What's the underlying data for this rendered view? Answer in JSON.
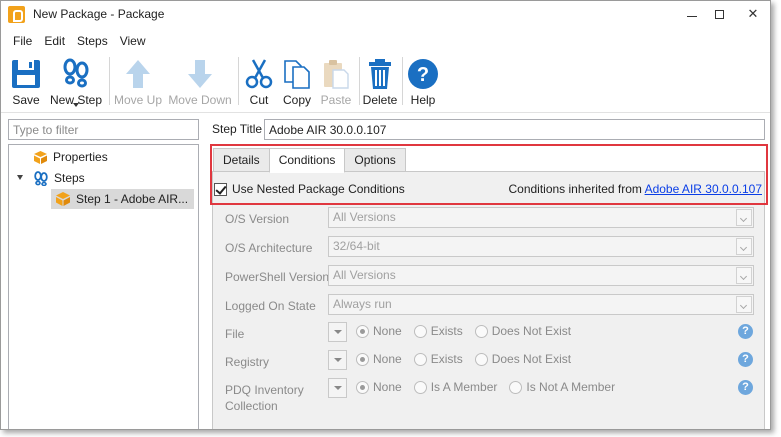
{
  "window": {
    "title": "New Package - Package"
  },
  "menu": {
    "items": [
      "File",
      "Edit",
      "Steps",
      "View"
    ]
  },
  "toolbar": {
    "save": "Save",
    "new_step": "New Step",
    "move_up": "Move Up",
    "move_down": "Move Down",
    "cut": "Cut",
    "copy": "Copy",
    "paste": "Paste",
    "delete": "Delete",
    "help": "Help"
  },
  "filter": {
    "placeholder": "Type to filter"
  },
  "tree": {
    "properties": "Properties",
    "steps": "Steps",
    "step1": "Step 1 - Adobe AIR..."
  },
  "step": {
    "title_label": "Step Title",
    "title_value": "Adobe AIR 30.0.0.107"
  },
  "tabs": {
    "details": "Details",
    "conditions": "Conditions",
    "options": "Options",
    "active": "Conditions"
  },
  "conditions": {
    "use_nested_label": "Use Nested Package Conditions",
    "use_nested_checked": true,
    "inherited_prefix": "Conditions inherited from ",
    "inherited_link": "Adobe AIR 30.0.0.107",
    "os_version_label": "O/S Version",
    "os_version_value": "All Versions",
    "os_arch_label": "O/S Architecture",
    "os_arch_value": "32/64-bit",
    "powershell_label": "PowerShell Version",
    "powershell_value": "All Versions",
    "logged_on_label": "Logged On State",
    "logged_on_value": "Always run",
    "file_label": "File",
    "file_opts": [
      "None",
      "Exists",
      "Does Not Exist"
    ],
    "registry_label": "Registry",
    "registry_opts": [
      "None",
      "Exists",
      "Does Not Exist"
    ],
    "pdq_label_line1": "PDQ Inventory",
    "pdq_label_line2": "Collection",
    "pdq_opts": [
      "None",
      "Is A Member",
      "Is Not A Member"
    ]
  },
  "colors": {
    "highlight": "#e0373f",
    "link": "#0a3ee6",
    "toolbar_blue": "#1a6fc2",
    "help_blue": "#6ea7dd"
  }
}
